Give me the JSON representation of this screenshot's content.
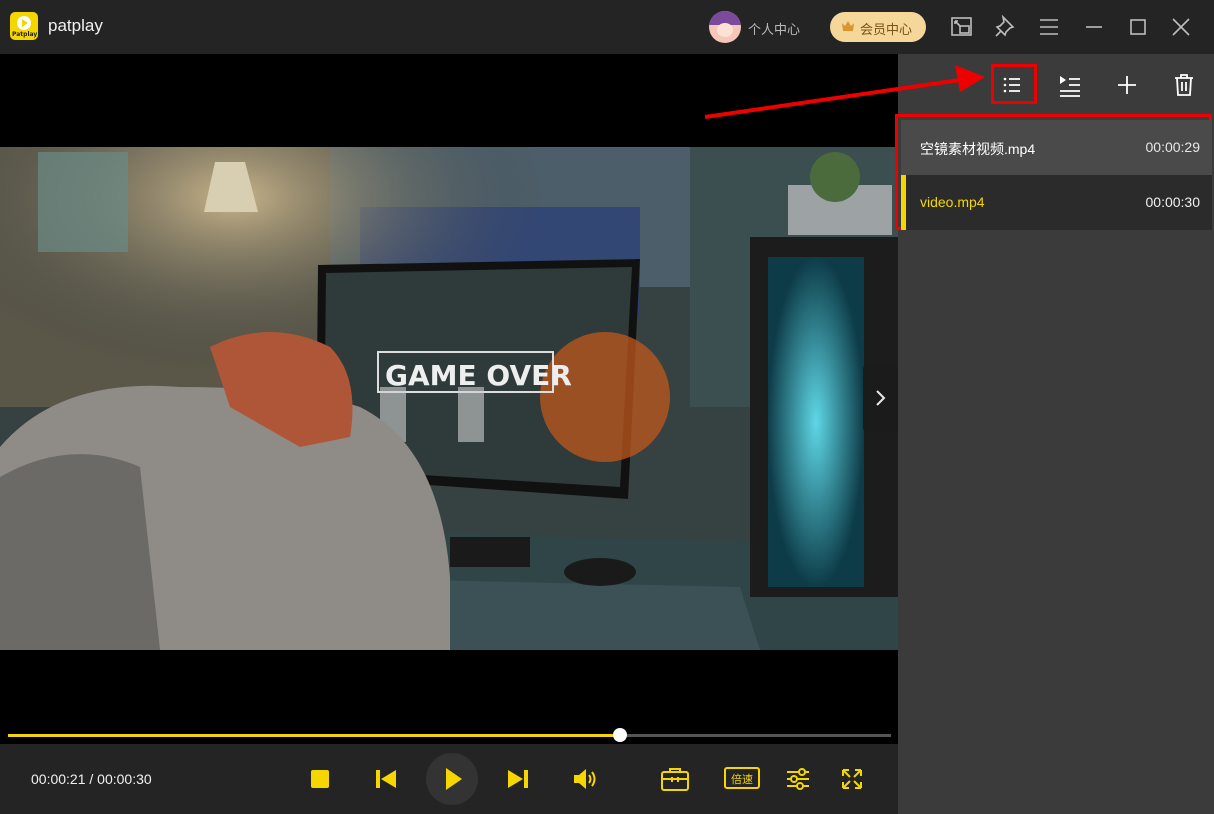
{
  "app": {
    "name": "patplay",
    "logo_text": "Patplay"
  },
  "header": {
    "personal_center": "个人中心",
    "vip_center": "会员中心"
  },
  "player": {
    "current_time": "00:00:21",
    "separator": " / ",
    "total_time": "00:00:30",
    "progress": 0.693,
    "speed_label": "倍速"
  },
  "playlist": {
    "items": [
      {
        "name": "空镜素材视频.mp4",
        "duration": "00:00:29",
        "active": false
      },
      {
        "name": "video.mp4",
        "duration": "00:00:30",
        "active": true
      }
    ]
  },
  "colors": {
    "accent": "#f6d600",
    "annotation": "#e00000",
    "panel_bg": "#3b3b3b",
    "titlebar_bg": "#242424"
  },
  "icons": {
    "titlebar": [
      "mini-player-icon",
      "pin-icon",
      "menu-icon",
      "minimize-icon",
      "maximize-icon",
      "close-icon"
    ],
    "playlist_toolbar": [
      "playlist-icon",
      "play-order-icon",
      "add-icon",
      "delete-icon"
    ],
    "controls": [
      "stop-icon",
      "previous-icon",
      "play-icon",
      "next-icon",
      "volume-icon",
      "toolbox-icon",
      "equalizer-icon",
      "fullscreen-icon"
    ]
  }
}
